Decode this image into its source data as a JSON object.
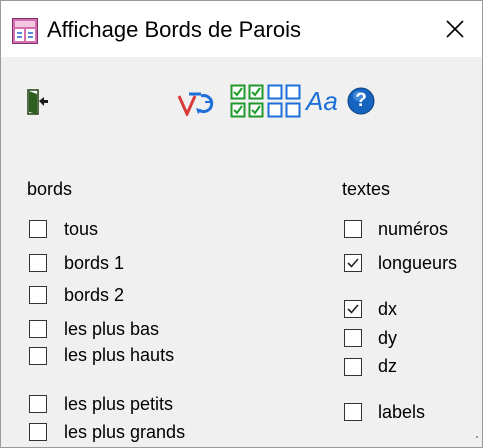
{
  "window": {
    "title": "Affichage Bords de Parois"
  },
  "toolbar": {
    "icons": [
      "exit-door-icon",
      "pan-rotate-icon",
      "check-all-icon",
      "uncheck-all-icon",
      "font-icon",
      "help-icon"
    ],
    "font_icon_text": "Aa",
    "help_icon_text": "?"
  },
  "bords": {
    "title": "bords",
    "items": [
      {
        "label": "tous",
        "checked": false
      },
      {
        "label": "bords 1",
        "checked": false
      },
      {
        "label": "bords 2",
        "checked": false
      },
      {
        "label": "les plus bas",
        "checked": false
      },
      {
        "label": "les plus hauts",
        "checked": false
      },
      {
        "label": "les plus petits",
        "checked": false
      },
      {
        "label": "les plus grands",
        "checked": false
      }
    ]
  },
  "textes": {
    "title": "textes",
    "items": [
      {
        "label": "numéros",
        "checked": false
      },
      {
        "label": "longueurs",
        "checked": true
      },
      {
        "label": "dx",
        "checked": true
      },
      {
        "label": "dy",
        "checked": false
      },
      {
        "label": "dz",
        "checked": false
      },
      {
        "label": "labels",
        "checked": false
      }
    ]
  },
  "colors": {
    "accent_blue": "#1e6fd9",
    "check_green": "#1f9a2b",
    "help_blue": "#1565c0",
    "exit_green": "#2f5f1e"
  }
}
